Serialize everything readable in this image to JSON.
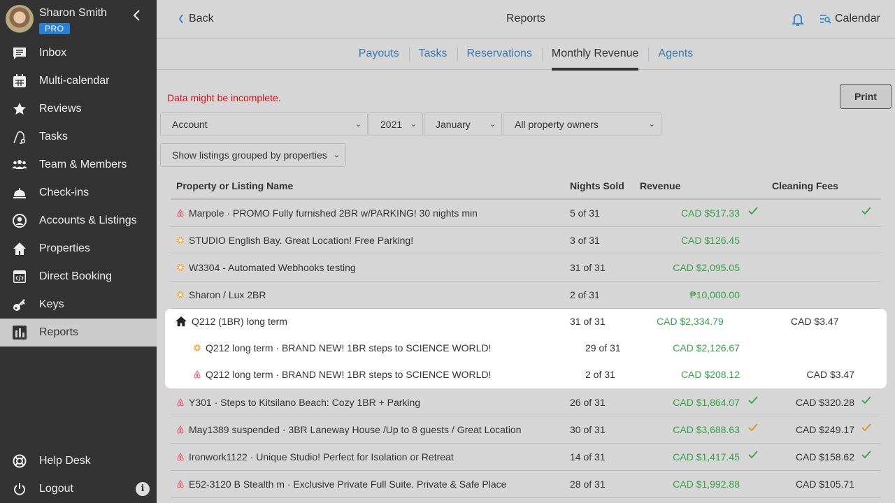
{
  "user": {
    "name": "Sharon Smith",
    "badge": "PRO"
  },
  "sidebar": {
    "items": [
      {
        "label": "Inbox",
        "icon": "chat-icon"
      },
      {
        "label": "Multi-calendar",
        "icon": "calendar-icon"
      },
      {
        "label": "Reviews",
        "icon": "star-icon"
      },
      {
        "label": "Tasks",
        "icon": "vacuum-icon"
      },
      {
        "label": "Team & Members",
        "icon": "team-icon"
      },
      {
        "label": "Check-ins",
        "icon": "bell-desk-icon"
      },
      {
        "label": "Accounts & Listings",
        "icon": "user-circle-icon"
      },
      {
        "label": "Properties",
        "icon": "home-icon"
      },
      {
        "label": "Direct Booking",
        "icon": "code-window-icon"
      },
      {
        "label": "Keys",
        "icon": "key-icon"
      },
      {
        "label": "Reports",
        "icon": "bar-chart-icon",
        "active": true
      }
    ],
    "bottom": [
      {
        "label": "Help Desk",
        "icon": "lifebuoy-icon"
      },
      {
        "label": "Logout",
        "icon": "power-icon"
      }
    ]
  },
  "header": {
    "back_label": "Back",
    "title": "Reports",
    "calendar_label": "Calendar"
  },
  "tabs": [
    {
      "label": "Payouts"
    },
    {
      "label": "Tasks"
    },
    {
      "label": "Reservations"
    },
    {
      "label": "Monthly Revenue",
      "active": true
    },
    {
      "label": "Agents"
    }
  ],
  "filters": {
    "warning": "Data might be incomplete.",
    "print_label": "Print",
    "account": "Account",
    "year": "2021",
    "month": "January",
    "owners": "All property owners",
    "grouping": "Show listings grouped by properties"
  },
  "table": {
    "headers": {
      "name": "Property or Listing Name",
      "nights": "Nights Sold",
      "revenue": "Revenue",
      "fees": "Cleaning Fees"
    },
    "rows": [
      {
        "name": "Marpole · PROMO Fully furnished 2BR w/PARKING! 30 nights min",
        "source": "airbnb",
        "nights": "5 of 31",
        "revenue": "CAD $517.33",
        "rev_check": "green",
        "fees": "",
        "fee_check": "green"
      },
      {
        "name": "STUDIO English Bay. Great Location! Free Parking!",
        "source": "booking",
        "nights": "3 of 31",
        "revenue": "CAD $126.45",
        "rev_check": "",
        "fees": "",
        "fee_check": ""
      },
      {
        "name": "W3304 - Automated Webhooks testing",
        "source": "booking",
        "nights": "31 of 31",
        "revenue": "CAD $2,095.05",
        "rev_check": "",
        "fees": "",
        "fee_check": ""
      },
      {
        "name": "Sharon / Lux 2BR",
        "source": "booking",
        "nights": "2 of 31",
        "revenue": "₱10,000.00",
        "rev_check": "",
        "fees": "",
        "fee_check": ""
      }
    ],
    "group": {
      "name": "Q212 (1BR) long term",
      "nights": "31 of 31",
      "revenue": "CAD $2,334.79",
      "fees": "CAD $3.47",
      "children": [
        {
          "name": "Q212 long term · BRAND NEW! 1BR steps to SCIENCE WORLD!",
          "source": "booking",
          "nights": "29 of 31",
          "revenue": "CAD $2,126.67",
          "fees": ""
        },
        {
          "name": "Q212 long term · BRAND NEW! 1BR steps to SCIENCE WORLD!",
          "source": "airbnb",
          "nights": "2 of 31",
          "revenue": "CAD $208.12",
          "fees": "CAD $3.47"
        }
      ]
    },
    "rows_after": [
      {
        "name": "Y301 · Steps to Kitsilano Beach: Cozy 1BR + Parking",
        "source": "airbnb",
        "nights": "26 of 31",
        "revenue": "CAD $1,864.07",
        "rev_check": "green",
        "fees": "CAD $320.28",
        "fee_check": "green"
      },
      {
        "name": "May1389 suspended · 3BR Laneway House /Up to 8 guests / Great Location",
        "source": "airbnb",
        "nights": "30 of 31",
        "revenue": "CAD $3,688.63",
        "rev_check": "orange",
        "fees": "CAD $249.17",
        "fee_check": "orange"
      },
      {
        "name": "Ironwork1122 · Unique Studio! Perfect for Isolation or Retreat",
        "source": "airbnb",
        "nights": "14 of 31",
        "revenue": "CAD $1,417.45",
        "rev_check": "green",
        "fees": "CAD $158.62",
        "fee_check": "green"
      },
      {
        "name": "E52-3120 B Stealth m · Exclusive Private Full Suite. Private & Safe Place",
        "source": "airbnb",
        "nights": "28 of 31",
        "revenue": "CAD $1,992.88",
        "rev_check": "",
        "fees": "CAD $105.71",
        "fee_check": ""
      }
    ]
  },
  "colors": {
    "accent": "#2a7fd0",
    "revenue": "#3aa04a",
    "check_green": "#3aa04a",
    "check_orange": "#e0901a",
    "warning": "#d0101a",
    "airbnb": "#e8505b",
    "booking": "#f0a030"
  }
}
